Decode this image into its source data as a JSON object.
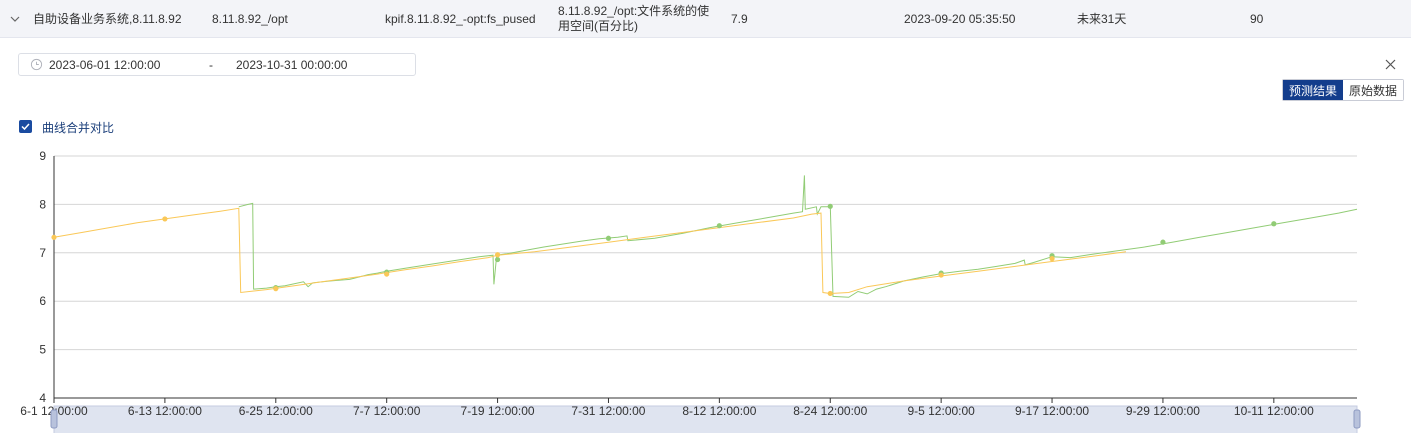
{
  "table_row": {
    "cells": [
      "自助设备业务系统,8.11.8.92",
      "8.11.8.92_/opt",
      "kpif.8.11.8.92_-opt:fs_pused",
      "8.11.8.92_/opt:文件系统的使用空间(百分比)",
      "7.9",
      "2023-09-20 05:35:50",
      "未来31天",
      "90"
    ]
  },
  "date_range": {
    "start": "2023-06-01 12:00:00",
    "separator": "-",
    "end": "2023-10-31 00:00:00"
  },
  "toggle": {
    "forecast_label": "预测结果",
    "raw_label": "原始数据",
    "active": "forecast"
  },
  "merge_checkbox": {
    "label": "曲线合并对比",
    "checked": true
  },
  "colors": {
    "actual": "#91cc75",
    "predicted": "#fac858",
    "accent": "#133d8c"
  },
  "chart_data": {
    "type": "line",
    "x_tick_labels": [
      "6-1 12:00:00",
      "6-13 12:00:00",
      "6-25 12:00:00",
      "7-7 12:00:00",
      "7-19 12:00:00",
      "7-31 12:00:00",
      "8-12 12:00:00",
      "8-24 12:00:00",
      "9-5 12:00:00",
      "9-17 12:00:00",
      "9-29 12:00:00",
      "10-11 12:00:00"
    ],
    "x_tick_days": [
      0,
      12,
      24,
      36,
      48,
      60,
      72,
      84,
      96,
      108,
      120,
      132
    ],
    "xlim_days": [
      0,
      141
    ],
    "ylim": [
      4,
      9
    ],
    "y_ticks": [
      4,
      5,
      6,
      7,
      8,
      9
    ],
    "grid": true,
    "series": [
      {
        "key": "actual",
        "points": [
          [
            20,
            7.95
          ],
          [
            21,
            8.0
          ],
          [
            21.5,
            8.02
          ],
          [
            21.6,
            6.25
          ],
          [
            23,
            6.27
          ],
          [
            24,
            6.3
          ],
          [
            25,
            6.32
          ],
          [
            26,
            6.36
          ],
          [
            27,
            6.4
          ],
          [
            27.5,
            6.3
          ],
          [
            28,
            6.38
          ],
          [
            30,
            6.42
          ],
          [
            32,
            6.45
          ],
          [
            33,
            6.5
          ],
          [
            34,
            6.55
          ],
          [
            35,
            6.58
          ],
          [
            36,
            6.62
          ],
          [
            38,
            6.68
          ],
          [
            40,
            6.74
          ],
          [
            42,
            6.8
          ],
          [
            44,
            6.86
          ],
          [
            46,
            6.92
          ],
          [
            47.5,
            6.95
          ],
          [
            47.6,
            6.35
          ],
          [
            47.9,
            6.95
          ],
          [
            49,
            6.98
          ],
          [
            51,
            7.05
          ],
          [
            53,
            7.12
          ],
          [
            55,
            7.18
          ],
          [
            57,
            7.24
          ],
          [
            59,
            7.29
          ],
          [
            61,
            7.32
          ],
          [
            62,
            7.35
          ],
          [
            62.1,
            7.25
          ],
          [
            65,
            7.3
          ],
          [
            68,
            7.4
          ],
          [
            71,
            7.52
          ],
          [
            74,
            7.62
          ],
          [
            77,
            7.72
          ],
          [
            80,
            7.82
          ],
          [
            81,
            7.85
          ],
          [
            81.2,
            8.6
          ],
          [
            81.3,
            7.9
          ],
          [
            82.5,
            7.95
          ],
          [
            82.6,
            7.8
          ],
          [
            83,
            7.95
          ],
          [
            84,
            7.95
          ],
          [
            84.3,
            6.1
          ],
          [
            86,
            6.08
          ],
          [
            87,
            6.2
          ],
          [
            88,
            6.15
          ],
          [
            89,
            6.25
          ],
          [
            90,
            6.3
          ],
          [
            92,
            6.42
          ],
          [
            94,
            6.5
          ],
          [
            96,
            6.57
          ],
          [
            98,
            6.62
          ],
          [
            100,
            6.66
          ],
          [
            102,
            6.72
          ],
          [
            104,
            6.78
          ],
          [
            105,
            6.85
          ],
          [
            105.1,
            6.75
          ],
          [
            106,
            6.8
          ],
          [
            108,
            6.92
          ],
          [
            110,
            6.9
          ],
          [
            112,
            6.96
          ],
          [
            115,
            7.04
          ],
          [
            118,
            7.12
          ],
          [
            121,
            7.22
          ],
          [
            124,
            7.32
          ],
          [
            127,
            7.42
          ],
          [
            130,
            7.52
          ],
          [
            133,
            7.62
          ],
          [
            136,
            7.72
          ],
          [
            139,
            7.82
          ],
          [
            141,
            7.9
          ]
        ]
      },
      {
        "key": "predicted",
        "points": [
          [
            0,
            7.32
          ],
          [
            3,
            7.42
          ],
          [
            6,
            7.52
          ],
          [
            9,
            7.62
          ],
          [
            12,
            7.7
          ],
          [
            15,
            7.78
          ],
          [
            18,
            7.86
          ],
          [
            20,
            7.92
          ],
          [
            20.2,
            6.18
          ],
          [
            23,
            6.24
          ],
          [
            26,
            6.32
          ],
          [
            29,
            6.4
          ],
          [
            32,
            6.48
          ],
          [
            35,
            6.56
          ],
          [
            38,
            6.65
          ],
          [
            41,
            6.73
          ],
          [
            44,
            6.82
          ],
          [
            47,
            6.9
          ],
          [
            48,
            6.95
          ],
          [
            52,
            7.02
          ],
          [
            56,
            7.12
          ],
          [
            60,
            7.22
          ],
          [
            64,
            7.32
          ],
          [
            68,
            7.42
          ],
          [
            72,
            7.52
          ],
          [
            76,
            7.62
          ],
          [
            80,
            7.72
          ],
          [
            82,
            7.8
          ],
          [
            83,
            7.82
          ],
          [
            83.2,
            6.18
          ],
          [
            84,
            6.16
          ],
          [
            86,
            6.18
          ],
          [
            88,
            6.3
          ],
          [
            92,
            6.42
          ],
          [
            96,
            6.52
          ],
          [
            100,
            6.62
          ],
          [
            104,
            6.72
          ],
          [
            108,
            6.82
          ],
          [
            112,
            6.92
          ],
          [
            116,
            7.02
          ]
        ]
      }
    ],
    "markers_actual": [
      [
        24,
        6.28
      ],
      [
        36,
        6.6
      ],
      [
        48,
        6.86
      ],
      [
        60,
        7.3
      ],
      [
        72,
        7.56
      ],
      [
        84,
        7.96
      ],
      [
        96,
        6.58
      ],
      [
        108,
        6.94
      ],
      [
        120,
        7.22
      ],
      [
        132,
        7.6
      ]
    ],
    "markers_predicted": [
      [
        0,
        7.32
      ],
      [
        12,
        7.7
      ],
      [
        24,
        6.26
      ],
      [
        36,
        6.56
      ],
      [
        48,
        6.96
      ],
      [
        84,
        6.16
      ],
      [
        96,
        6.54
      ],
      [
        108,
        6.88
      ]
    ]
  }
}
